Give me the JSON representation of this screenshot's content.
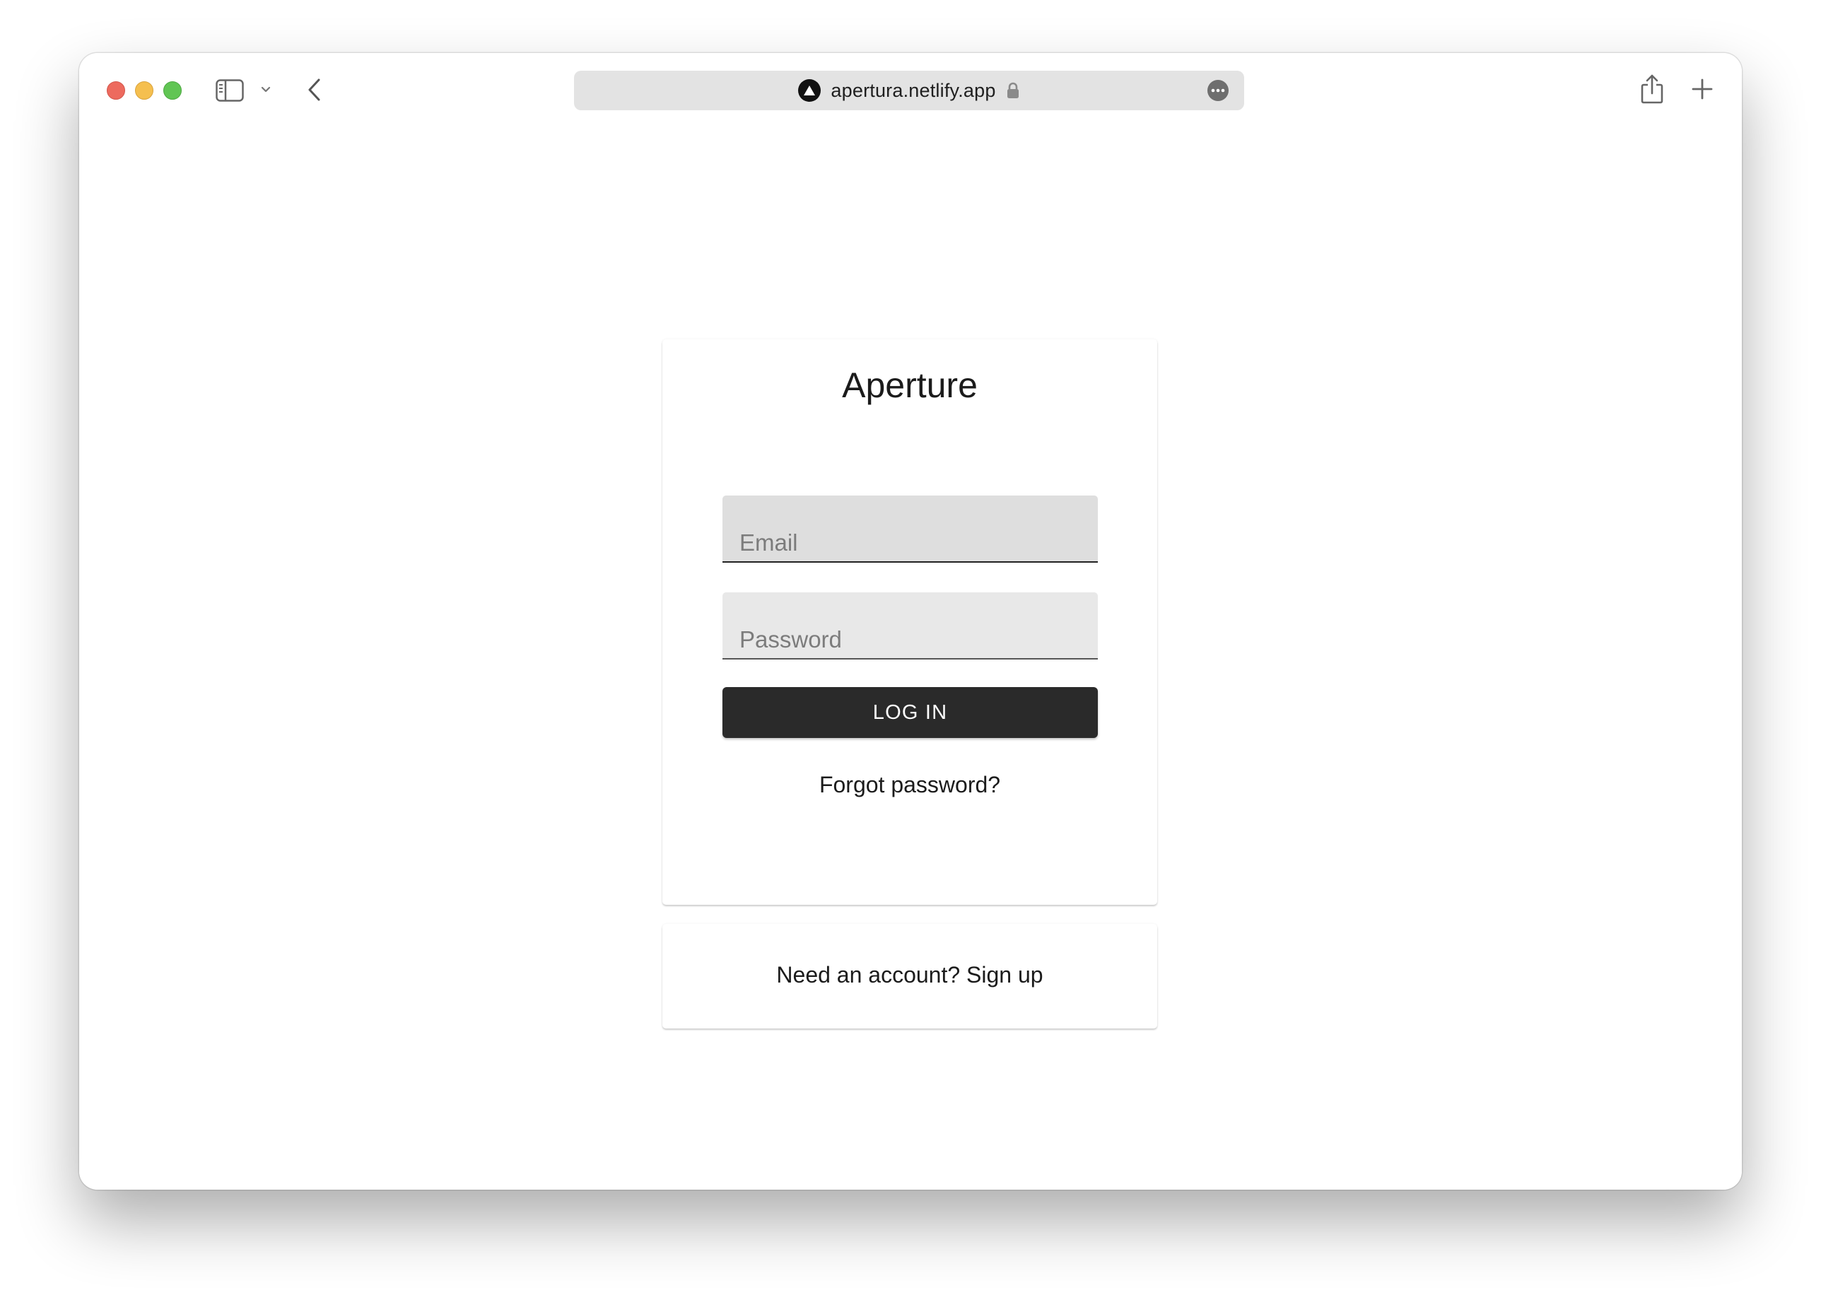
{
  "browser": {
    "url": "apertura.netlify.app",
    "icons": {
      "close": "window-close-icon",
      "minimize": "window-minimize-icon",
      "maximize": "window-maximize-icon",
      "sidebar": "sidebar-icon",
      "sidebar_menu": "chevron-down-icon",
      "back": "chevron-left-icon",
      "site": "triangle-logo-icon",
      "secure": "lock-icon",
      "page_menu": "more-icon",
      "share": "share-icon",
      "new_tab": "plus-icon"
    }
  },
  "login": {
    "title": "Aperture",
    "email_placeholder": "Email",
    "password_placeholder": "Password",
    "submit_label": "LOG IN",
    "forgot_label": "Forgot password?"
  },
  "signup": {
    "prompt_label": "Need an account? Sign up"
  },
  "colors": {
    "button_bg": "#2a2a2a",
    "field_bg": "#e8e8e8",
    "close": "#ed6a5e",
    "minimize": "#f5bf4f",
    "maximize": "#61c554"
  }
}
